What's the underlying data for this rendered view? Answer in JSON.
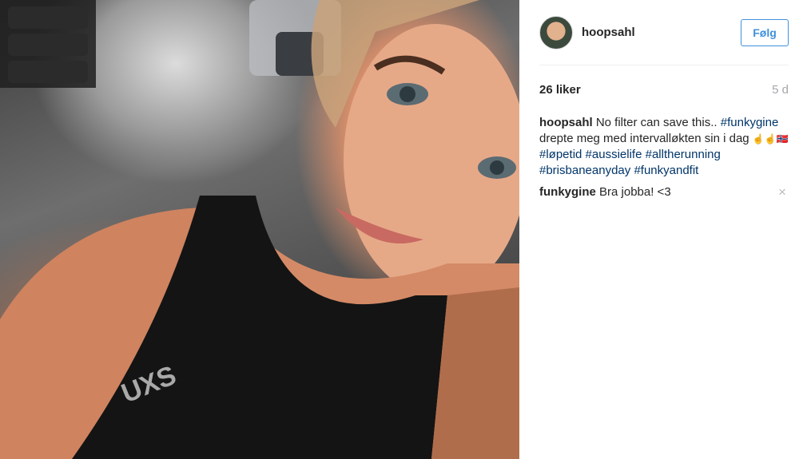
{
  "post": {
    "username": "hoopsahl",
    "follow_label": "Følg",
    "likes": "26 liker",
    "time": "5 d",
    "caption": {
      "author": "hoopsahl",
      "parts": [
        {
          "type": "text",
          "text": " No filter can save this.. "
        },
        {
          "type": "tag",
          "text": "#funkygine"
        },
        {
          "type": "text",
          "text": " drepte meg med intervalløkten sin i dag "
        },
        {
          "type": "emoji",
          "text": "☝☝"
        },
        {
          "type": "emoji",
          "text": "🇳🇴"
        },
        {
          "type": "text",
          "text": " "
        },
        {
          "type": "tag",
          "text": "#løpetid"
        },
        {
          "type": "text",
          "text": " "
        },
        {
          "type": "tag",
          "text": "#aussielife"
        },
        {
          "type": "text",
          "text": " "
        },
        {
          "type": "tag",
          "text": "#alltherunning"
        },
        {
          "type": "text",
          "text": " "
        },
        {
          "type": "tag",
          "text": "#brisbaneanyday"
        },
        {
          "type": "text",
          "text": " "
        },
        {
          "type": "tag",
          "text": "#funkyandfit"
        }
      ]
    },
    "comments": [
      {
        "author": "funkygine",
        "text": " Bra jobba! <3"
      }
    ],
    "close_glyph": "×"
  },
  "photo": {
    "shirt_logo": "UXS"
  }
}
